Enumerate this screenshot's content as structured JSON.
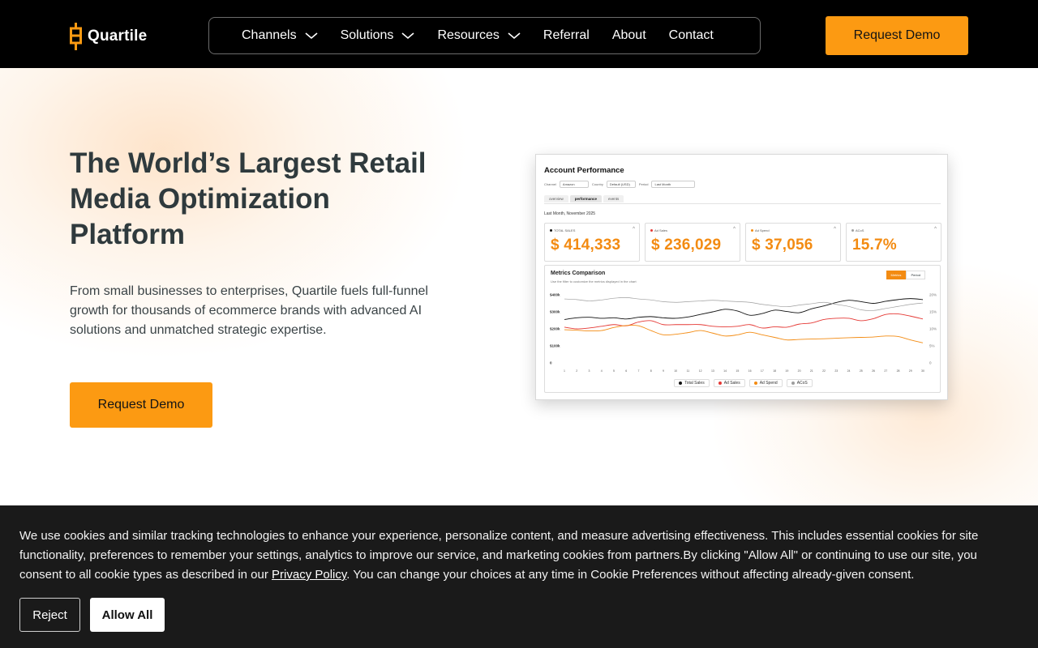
{
  "header": {
    "logo_text": "Quartile",
    "nav": [
      {
        "label": "Channels",
        "dropdown": true,
        "icon": "chevron-down-icon"
      },
      {
        "label": "Solutions",
        "dropdown": true,
        "icon": "chevron-down-icon"
      },
      {
        "label": "Resources",
        "dropdown": true,
        "icon": "chevron-down-icon"
      },
      {
        "label": "Referral",
        "dropdown": false
      },
      {
        "label": "About",
        "dropdown": false
      },
      {
        "label": "Contact",
        "dropdown": false
      }
    ],
    "cta_label": "Request Demo"
  },
  "hero": {
    "title": "The World’s Largest Retail Media Optimization Platform",
    "subtitle": "From small businesses to enterprises, Quartile fuels full-funnel growth for thousands of ecommerce brands with advanced AI solutions and unmatched strategic expertise.",
    "cta_label": "Request Demo"
  },
  "dashboard": {
    "title": "Account Performance",
    "filters": [
      {
        "label": "Channel",
        "value": "Amazon"
      },
      {
        "label": "Country",
        "value": "Default (USD)"
      },
      {
        "label": "Period",
        "value": "Last Month"
      }
    ],
    "tabs": [
      "overview",
      "performance",
      "events"
    ],
    "active_tab": "performance",
    "period_label": "Last Month, November 2025",
    "kpis": [
      {
        "label": "TOTAL SALES",
        "value": "$ 414,333",
        "dot_color": "#111111"
      },
      {
        "label": "Ad Sales",
        "value": "$ 236,029",
        "dot_color": "#e53935"
      },
      {
        "label": "Ad Spend",
        "value": "$ 37,056",
        "dot_color": "#f38b12"
      },
      {
        "label": "ACoS",
        "value": "15.7%",
        "dot_color": "#9e9e9e"
      }
    ],
    "metrics_title": "Metrics Comparison",
    "metrics_subtitle": "Use the filter to customize the metrics displayed in the chart",
    "toggle": {
      "options": [
        "Metrics",
        "Period"
      ],
      "active": "Metrics"
    }
  },
  "chart_data": {
    "type": "line",
    "x": [
      1,
      2,
      3,
      4,
      5,
      6,
      7,
      8,
      9,
      10,
      11,
      12,
      13,
      14,
      15,
      16,
      17,
      18,
      19,
      20,
      21,
      22,
      23,
      24,
      25,
      26,
      27,
      28,
      29,
      30
    ],
    "y_left_ticks": [
      "$400k",
      "$300k",
      "$200k",
      "$100k",
      "0"
    ],
    "y_right_ticks": [
      "20%",
      "15%",
      "10%",
      "5%",
      "0"
    ],
    "ylim_left": [
      0,
      400000
    ],
    "ylim_right": [
      0,
      20
    ],
    "series": [
      {
        "name": "Total Sales",
        "axis": "left",
        "color": "#111111",
        "values": [
          255000,
          265000,
          268000,
          262000,
          265000,
          258000,
          268000,
          272000,
          265000,
          262000,
          270000,
          285000,
          300000,
          315000,
          305000,
          280000,
          290000,
          310000,
          302000,
          295000,
          318000,
          335000,
          355000,
          368000,
          360000,
          350000,
          362000,
          372000,
          378000,
          372000
        ]
      },
      {
        "name": "Ad Sales",
        "axis": "left",
        "color": "#e53935",
        "values": [
          210000,
          200000,
          205000,
          215000,
          225000,
          218000,
          240000,
          248000,
          225000,
          225000,
          225000,
          225000,
          215000,
          212000,
          215000,
          225000,
          205000,
          212000,
          210000,
          228000,
          235000,
          255000,
          262000,
          262000,
          248000,
          260000,
          285000,
          288000,
          275000,
          258000
        ]
      },
      {
        "name": "Ad Spend",
        "axis": "left",
        "color": "#f38b12",
        "values": [
          195000,
          192000,
          188000,
          190000,
          208000,
          220000,
          218000,
          190000,
          165000,
          168000,
          178000,
          190000,
          175000,
          158000,
          165000,
          180000,
          165000,
          150000,
          135000,
          138000,
          140000,
          142000,
          145000,
          148000,
          150000,
          152000,
          158000,
          155000,
          135000,
          118000
        ]
      },
      {
        "name": "ACoS",
        "axis": "right",
        "color": "#9e9e9e",
        "values": [
          18.8,
          18.6,
          18.2,
          18.5,
          19.0,
          19.2,
          18.8,
          18.5,
          18.0,
          17.8,
          18.0,
          18.2,
          18.4,
          18.2,
          18.0,
          17.8,
          17.2,
          16.8,
          16.5,
          17.0,
          17.4,
          17.8,
          17.2,
          16.6,
          15.6,
          15.4,
          16.0,
          16.6,
          17.2,
          17.6
        ]
      }
    ]
  },
  "cookie": {
    "text_before_link": "We use cookies and similar tracking technologies to enhance your experience, personalize content, and measure advertising effectiveness. This includes essential cookies for site functionality, preferences to remember your settings, analytics to improve our service, and marketing cookies from partners.By clicking \"Allow All\" or continuing to use our site, you consent to all cookie types as described in our ",
    "link_text": "Privacy Policy",
    "text_after_link": ". You can change your choices at any time in Cookie Preferences without affecting already-given consent.",
    "reject_label": "Reject",
    "allow_label": "Allow All"
  },
  "colors": {
    "accent": "#fc9a12",
    "header_bg": "#000000",
    "banner_bg": "#1a1a1a",
    "kpi_value": "#f38b12"
  }
}
